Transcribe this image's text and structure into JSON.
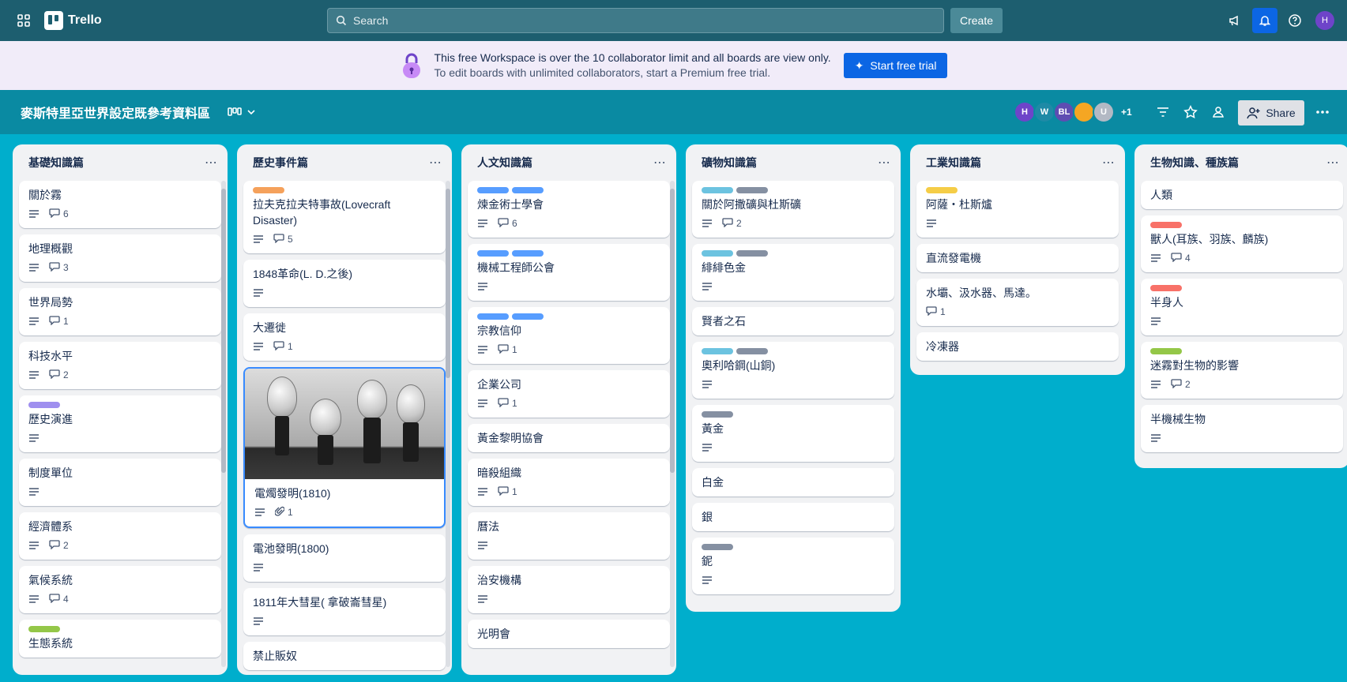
{
  "topbar": {
    "app_name": "Trello",
    "search_placeholder": "Search",
    "create_label": "Create",
    "user_initial": "H"
  },
  "banner": {
    "line1": "This free Workspace is over the 10 collaborator limit and all boards are view only.",
    "line2": "To edit boards with unlimited collaborators, start a Premium free trial.",
    "button_label": "Start free trial"
  },
  "board": {
    "title": "麥斯特里亞世界設定既參考資料區",
    "members": [
      {
        "initials": "H",
        "color": "#6e44c9"
      },
      {
        "initials": "W",
        "color": "#1f8aa6"
      },
      {
        "initials": "BL",
        "color": "#5e4db2"
      },
      {
        "initials": "",
        "color": "#f5a623"
      },
      {
        "initials": "U",
        "color": "#b3b9c4"
      }
    ],
    "extra_members": "+1",
    "share_label": "Share"
  },
  "colors": {
    "orange": "#f5a15b",
    "blue": "#579dff",
    "teal": "#6cc3e0",
    "gray": "#8590a2",
    "yellow": "#f5cd47",
    "red": "#f87168",
    "green": "#94c748",
    "purple": "#9f8fef"
  },
  "lists": [
    {
      "title": "基礎知識篇",
      "cards": [
        {
          "title": "關於霧",
          "labels": [],
          "desc": true,
          "comments": "6"
        },
        {
          "title": "地理概觀",
          "labels": [],
          "desc": true,
          "comments": "3"
        },
        {
          "title": "世界局勢",
          "labels": [],
          "desc": true,
          "comments": "1"
        },
        {
          "title": "科技水平",
          "labels": [],
          "desc": true,
          "comments": "2"
        },
        {
          "title": "歷史演進",
          "labels": [
            "purple"
          ],
          "desc": true,
          "comments": ""
        },
        {
          "title": "制度單位",
          "labels": [],
          "desc": true,
          "comments": ""
        },
        {
          "title": "經濟體系",
          "labels": [],
          "desc": true,
          "comments": "2"
        },
        {
          "title": "氣候系統",
          "labels": [],
          "desc": true,
          "comments": "4"
        },
        {
          "title": "生態系統",
          "labels": [
            "green"
          ],
          "desc": false,
          "comments": ""
        }
      ]
    },
    {
      "title": "歷史事件篇",
      "cards": [
        {
          "title": "拉夫克拉夫特事故(Lovecraft Disaster)",
          "labels": [
            "orange"
          ],
          "desc": true,
          "comments": "5"
        },
        {
          "title": "1848革命(L. D.之後)",
          "labels": [],
          "desc": true,
          "comments": ""
        },
        {
          "title": "大遷徙",
          "labels": [],
          "desc": true,
          "comments": "1"
        },
        {
          "title": "電燭發明(1810)",
          "labels": [],
          "desc": true,
          "comments": "",
          "attachments": "1",
          "cover": true
        },
        {
          "title": "電池發明(1800)",
          "labels": [],
          "desc": true,
          "comments": ""
        },
        {
          "title": "1811年大彗星( 拿破崙彗星)",
          "labels": [],
          "desc": true,
          "comments": ""
        },
        {
          "title": "禁止販奴",
          "labels": [],
          "desc": false,
          "comments": ""
        }
      ]
    },
    {
      "title": "人文知識篇",
      "cards": [
        {
          "title": "煉金術士學會",
          "labels": [
            "blue",
            "blue"
          ],
          "desc": true,
          "comments": "6"
        },
        {
          "title": "機械工程師公會",
          "labels": [
            "blue",
            "blue"
          ],
          "desc": true,
          "comments": ""
        },
        {
          "title": "宗教信仰",
          "labels": [
            "blue",
            "blue"
          ],
          "desc": true,
          "comments": "1"
        },
        {
          "title": "企業公司",
          "labels": [],
          "desc": true,
          "comments": "1"
        },
        {
          "title": "黃金黎明協會",
          "labels": [],
          "desc": false,
          "comments": ""
        },
        {
          "title": "暗殺組織",
          "labels": [],
          "desc": true,
          "comments": "1"
        },
        {
          "title": "曆法",
          "labels": [],
          "desc": true,
          "comments": ""
        },
        {
          "title": "治安機構",
          "labels": [],
          "desc": true,
          "comments": ""
        },
        {
          "title": "光明會",
          "labels": [],
          "desc": false,
          "comments": ""
        }
      ]
    },
    {
      "title": "礦物知識篇",
      "cards": [
        {
          "title": "關於阿撒礦與杜斯礦",
          "labels": [
            "teal",
            "gray"
          ],
          "desc": true,
          "comments": "2"
        },
        {
          "title": "緋緋色金",
          "labels": [
            "teal",
            "gray"
          ],
          "desc": true,
          "comments": ""
        },
        {
          "title": "賢者之石",
          "labels": [],
          "desc": false,
          "comments": ""
        },
        {
          "title": "奧利哈鋼(山銅)",
          "labels": [
            "teal",
            "gray"
          ],
          "desc": true,
          "comments": ""
        },
        {
          "title": "黃金",
          "labels": [
            "gray"
          ],
          "desc": true,
          "comments": ""
        },
        {
          "title": "白金",
          "labels": [],
          "desc": false,
          "comments": ""
        },
        {
          "title": "銀",
          "labels": [],
          "desc": false,
          "comments": ""
        },
        {
          "title": "鈮",
          "labels": [
            "gray"
          ],
          "desc": true,
          "comments": ""
        }
      ]
    },
    {
      "title": "工業知識篇",
      "cards": [
        {
          "title": "阿薩・杜斯爐",
          "labels": [
            "yellow"
          ],
          "desc": true,
          "comments": ""
        },
        {
          "title": "直流發電機",
          "labels": [],
          "desc": false,
          "comments": ""
        },
        {
          "title": "水壩、汲水器、馬達。",
          "labels": [],
          "desc": false,
          "comments": "1"
        },
        {
          "title": "冷凍器",
          "labels": [],
          "desc": false,
          "comments": ""
        }
      ]
    },
    {
      "title": "生物知識、種族篇",
      "cards": [
        {
          "title": "人類",
          "labels": [],
          "desc": false,
          "comments": ""
        },
        {
          "title": "獸人(耳族、羽族、麟族)",
          "labels": [
            "red"
          ],
          "desc": true,
          "comments": "4"
        },
        {
          "title": "半身人",
          "labels": [
            "red"
          ],
          "desc": true,
          "comments": ""
        },
        {
          "title": "迷霧對生物的影響",
          "labels": [
            "green"
          ],
          "desc": true,
          "comments": "2"
        },
        {
          "title": "半機械生物",
          "labels": [],
          "desc": true,
          "comments": ""
        }
      ]
    }
  ]
}
